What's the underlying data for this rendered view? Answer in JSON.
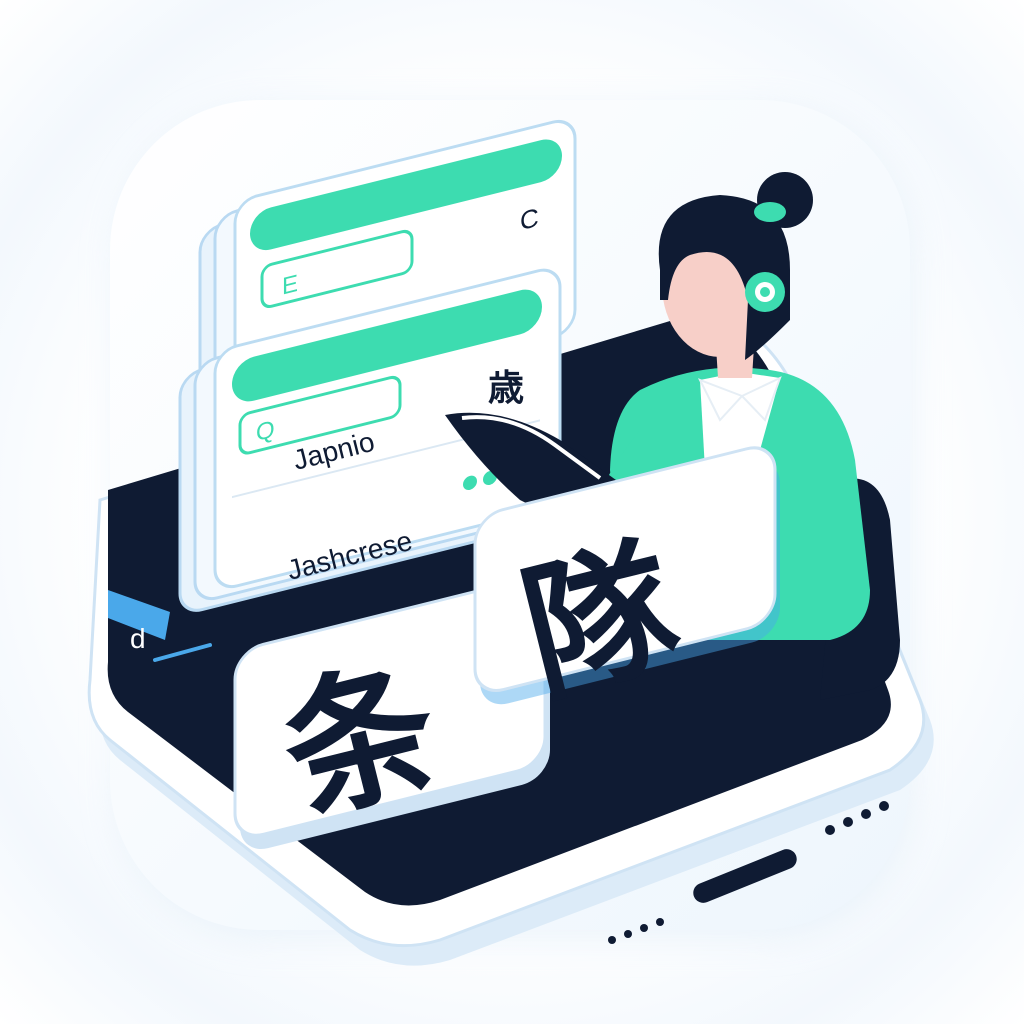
{
  "icon_tile": {
    "background": "#ffffff",
    "shadow": "#dbeaf8"
  },
  "palette": {
    "navy": "#0f1b33",
    "mint": "#3ddcb0",
    "sky": "#4aa8ea",
    "skin": "#f7cfc8",
    "white": "#ffffff"
  },
  "back_card": {
    "tab_label": "E",
    "corner_glyph": "C"
  },
  "front_card": {
    "search_glyph": "Q",
    "kanji": "歳",
    "line_1": "Japnio",
    "line_2": "Jashcrese"
  },
  "phone": {
    "search_glyph": "d"
  },
  "tiles": [
    {
      "glyph": "条"
    },
    {
      "glyph": "隊"
    }
  ],
  "person": {
    "headset_color": "#3ddcb0",
    "jacket_color": "#3ddcb0",
    "book_color": "#0f1b33"
  }
}
